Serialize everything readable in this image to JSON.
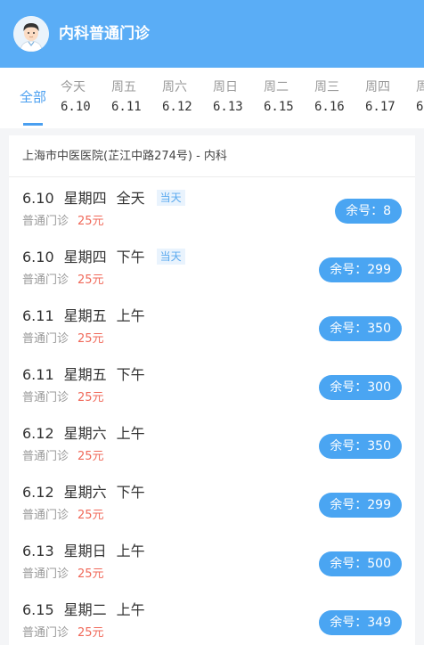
{
  "header": {
    "title": "内科普通门诊"
  },
  "tabs": {
    "all_label": "全部",
    "days": [
      {
        "weekday": "今天",
        "date": "6.10"
      },
      {
        "weekday": "周五",
        "date": "6.11"
      },
      {
        "weekday": "周六",
        "date": "6.12"
      },
      {
        "weekday": "周日",
        "date": "6.13"
      },
      {
        "weekday": "周二",
        "date": "6.15"
      },
      {
        "weekday": "周三",
        "date": "6.16"
      },
      {
        "weekday": "周四",
        "date": "6.17"
      },
      {
        "weekday": "周",
        "date": "6"
      }
    ]
  },
  "hospital": {
    "label": "上海市中医医院(芷江中路274号) - 内科"
  },
  "slots": [
    {
      "date": "6.10",
      "weekday": "星期四",
      "period": "全天",
      "today": "当天",
      "type": "普通门诊",
      "price": "25元",
      "remain": "余号：8"
    },
    {
      "date": "6.10",
      "weekday": "星期四",
      "period": "下午",
      "today": "当天",
      "type": "普通门诊",
      "price": "25元",
      "remain": "余号：299"
    },
    {
      "date": "6.11",
      "weekday": "星期五",
      "period": "上午",
      "type": "普通门诊",
      "price": "25元",
      "remain": "余号：350"
    },
    {
      "date": "6.11",
      "weekday": "星期五",
      "period": "下午",
      "type": "普通门诊",
      "price": "25元",
      "remain": "余号：300"
    },
    {
      "date": "6.12",
      "weekday": "星期六",
      "period": "上午",
      "type": "普通门诊",
      "price": "25元",
      "remain": "余号：350"
    },
    {
      "date": "6.12",
      "weekday": "星期六",
      "period": "下午",
      "type": "普通门诊",
      "price": "25元",
      "remain": "余号：299"
    },
    {
      "date": "6.13",
      "weekday": "星期日",
      "period": "上午",
      "type": "普通门诊",
      "price": "25元",
      "remain": "余号：500"
    },
    {
      "date": "6.15",
      "weekday": "星期二",
      "period": "上午",
      "type": "普通门诊",
      "price": "25元",
      "remain": "余号：349"
    }
  ],
  "colors": {
    "header_bg": "#5aadf6",
    "accent": "#4aa5f2",
    "price": "#f0695a"
  },
  "icons": {
    "avatar": "doctor-avatar-icon"
  }
}
